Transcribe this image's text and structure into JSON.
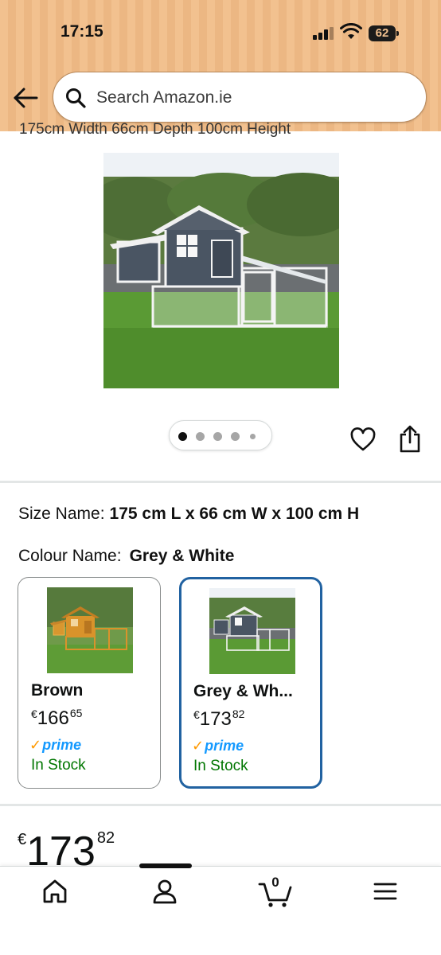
{
  "status_bar": {
    "time": "17:15",
    "battery": "62"
  },
  "header": {
    "back_icon": "arrow-left-icon",
    "search": {
      "icon": "search-icon",
      "placeholder": "Search Amazon.ie"
    }
  },
  "product": {
    "title_partial": "175cm Width 66cm Depth 100cm Height",
    "image_count": 5,
    "active_image_index": 0,
    "wishlist_icon": "heart-icon",
    "share_icon": "share-icon",
    "size_label": "Size Name:",
    "size_value": "175 cm L x 66 cm W x 100 cm H",
    "colour_label": "Colour Name:",
    "colour_value": "Grey & White",
    "variants": [
      {
        "name": "Brown",
        "currency": "€",
        "price_whole": "166",
        "price_cents": "65",
        "prime": "prime",
        "stock": "In Stock",
        "selected": false
      },
      {
        "name": "Grey & Wh...",
        "currency": "€",
        "price_whole": "173",
        "price_cents": "82",
        "prime": "prime",
        "stock": "In Stock",
        "selected": true
      }
    ],
    "price": {
      "currency": "€",
      "whole": "173",
      "cents": "82"
    }
  },
  "bottom_nav": {
    "items": [
      {
        "icon": "home-icon"
      },
      {
        "icon": "account-icon"
      },
      {
        "icon": "cart-icon",
        "count": "0"
      },
      {
        "icon": "menu-icon"
      }
    ]
  },
  "colors": {
    "header_bg": "#f2c18f",
    "selected_border": "#2162a1",
    "prime_blue": "#1399ff",
    "prime_check": "#ff9900",
    "in_stock_green": "#007600"
  }
}
